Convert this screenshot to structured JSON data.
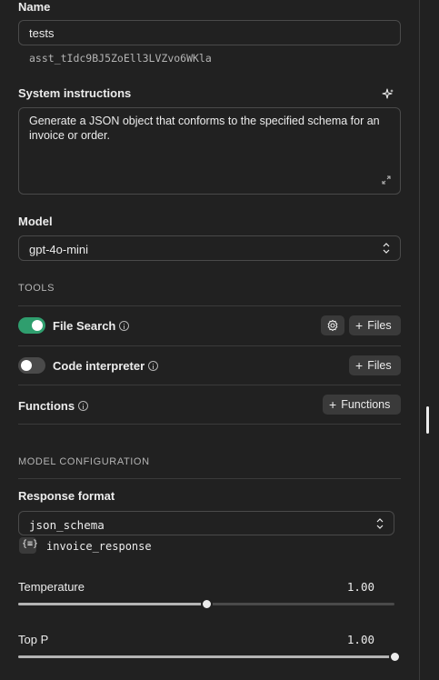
{
  "name": {
    "label": "Name",
    "value": "tests",
    "assistant_id": "asst_tIdc9BJ5ZoEll3LVZvo6WKla"
  },
  "instructions": {
    "label": "System instructions",
    "text": "Generate a JSON object that conforms to the specified schema for an invoice or order.",
    "generate_icon": "sparkle-icon",
    "expand_icon": "expand-icon"
  },
  "model": {
    "label": "Model",
    "selected": "gpt-4o-mini"
  },
  "tools": {
    "section": "TOOLS",
    "file_search": {
      "label": "File Search",
      "enabled": true,
      "files_button": "Files"
    },
    "code_interpreter": {
      "label": "Code interpreter",
      "enabled": false,
      "files_button": "Files"
    },
    "functions": {
      "label": "Functions",
      "button": "Functions"
    }
  },
  "model_config": {
    "section": "MODEL CONFIGURATION",
    "response_format": {
      "label": "Response format",
      "selected": "json_schema",
      "schema_name": "invoice_response"
    },
    "temperature": {
      "label": "Temperature",
      "value_text": "1.00",
      "fraction": 0.5
    },
    "top_p": {
      "label": "Top P",
      "value_text": "1.00",
      "fraction": 1.0
    }
  },
  "colors": {
    "toggle_on": "#2f9e6e",
    "toggle_off": "#4a4a4a",
    "background": "#212121"
  }
}
